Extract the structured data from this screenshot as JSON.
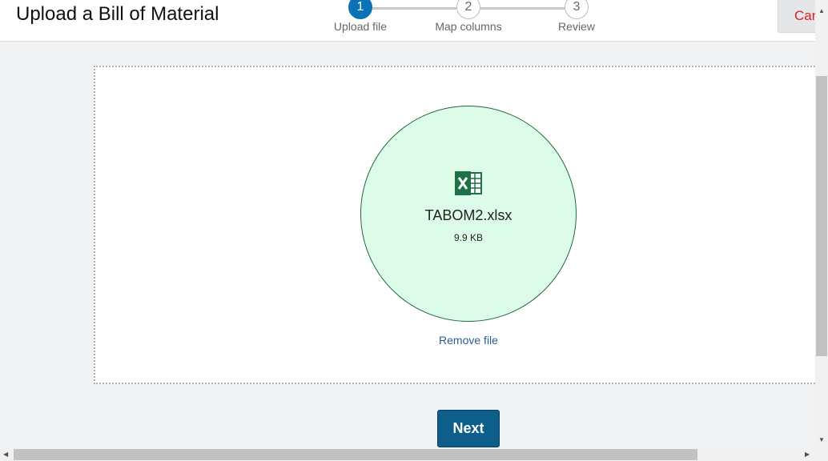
{
  "header": {
    "title": "Upload a Bill of Material",
    "cancel_label": "Cancel"
  },
  "stepper": {
    "steps": [
      {
        "number": "1",
        "label": "Upload file",
        "state": "active"
      },
      {
        "number": "2",
        "label": "Map columns",
        "state": "inactive"
      },
      {
        "number": "3",
        "label": "Review",
        "state": "inactive"
      }
    ]
  },
  "upload": {
    "file_icon": "excel-file-icon",
    "file_name": "TABOM2.xlsx",
    "file_size": "9.9 KB",
    "remove_label": "Remove file"
  },
  "footer": {
    "next_label": "Next"
  },
  "colors": {
    "accent": "#0b72b5",
    "next_button": "#0e5e8c",
    "cancel_text": "#e02020",
    "file_circle_fill": "#dcfbe9",
    "excel_green": "#1e7145",
    "link": "#2a5d93"
  }
}
